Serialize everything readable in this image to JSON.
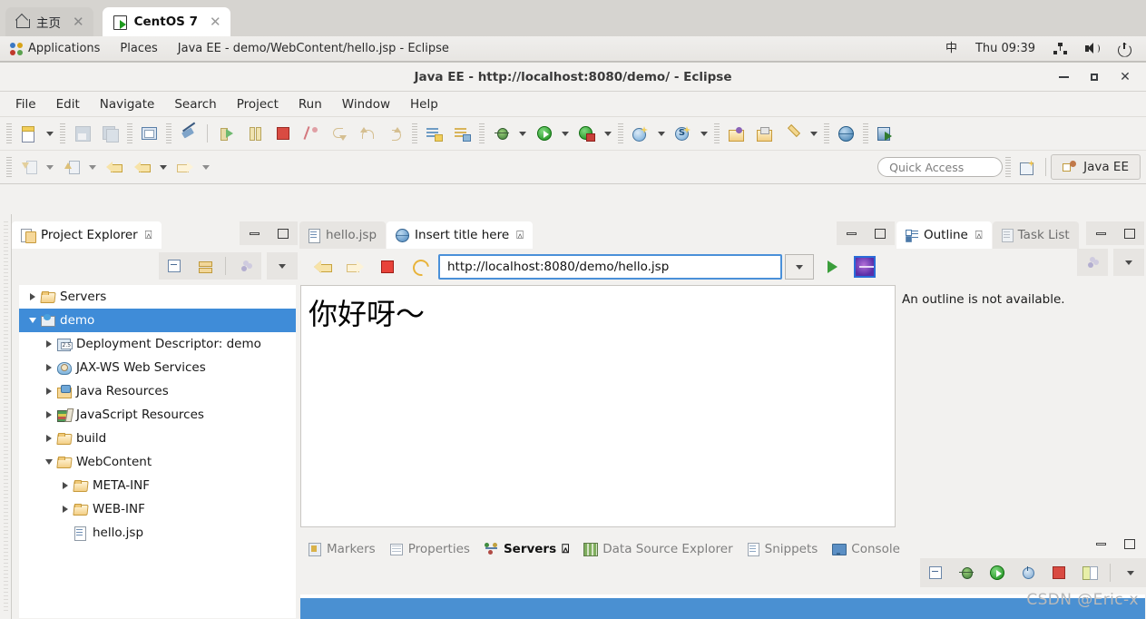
{
  "vm_tabs": [
    {
      "label": "主页",
      "icon": "home-icon",
      "active": false
    },
    {
      "label": "CentOS 7",
      "icon": "centos-icon",
      "active": true
    }
  ],
  "gnome_panel": {
    "applications": "Applications",
    "places": "Places",
    "window_title": "Java EE - demo/WebContent/hello.jsp - Eclipse",
    "input_method": "中",
    "clock": "Thu 09:39"
  },
  "eclipse": {
    "title": "Java EE - http://localhost:8080/demo/ - Eclipse",
    "menu": [
      "File",
      "Edit",
      "Navigate",
      "Search",
      "Project",
      "Run",
      "Window",
      "Help"
    ],
    "quick_access_placeholder": "Quick Access",
    "perspective": "Java EE"
  },
  "project_explorer": {
    "tab_label": "Project Explorer",
    "tree": [
      {
        "label": "Servers",
        "indent": 0,
        "twisty": "right",
        "icon": "folder-icon",
        "selected": false
      },
      {
        "label": "demo",
        "indent": 0,
        "twisty": "down",
        "icon": "project-icon",
        "selected": true
      },
      {
        "label": "Deployment Descriptor: demo",
        "indent": 1,
        "twisty": "right",
        "icon": "deployment-descriptor-icon",
        "selected": false
      },
      {
        "label": "JAX-WS Web Services",
        "indent": 1,
        "twisty": "right",
        "icon": "web-services-icon",
        "selected": false
      },
      {
        "label": "Java Resources",
        "indent": 1,
        "twisty": "right",
        "icon": "java-resources-icon",
        "selected": false
      },
      {
        "label": "JavaScript Resources",
        "indent": 1,
        "twisty": "right",
        "icon": "javascript-resources-icon",
        "selected": false
      },
      {
        "label": "build",
        "indent": 1,
        "twisty": "right",
        "icon": "folder-icon",
        "selected": false
      },
      {
        "label": "WebContent",
        "indent": 1,
        "twisty": "down",
        "icon": "folder-icon",
        "selected": false
      },
      {
        "label": "META-INF",
        "indent": 2,
        "twisty": "right",
        "icon": "folder-icon",
        "selected": false
      },
      {
        "label": "WEB-INF",
        "indent": 2,
        "twisty": "right",
        "icon": "folder-icon",
        "selected": false
      },
      {
        "label": "hello.jsp",
        "indent": 2,
        "twisty": "none",
        "icon": "jsp-file-icon",
        "selected": false
      }
    ]
  },
  "editor": {
    "tabs": [
      {
        "label": "hello.jsp",
        "icon": "jsp-file-icon",
        "active": false,
        "closable": false
      },
      {
        "label": "Insert title here",
        "icon": "globe-icon",
        "active": true,
        "closable": true
      }
    ],
    "browser": {
      "url": "http://localhost:8080/demo/hello.jsp",
      "page_text": "你好呀～"
    }
  },
  "outline": {
    "tabs": [
      {
        "label": "Outline",
        "icon": "outline-icon",
        "active": true,
        "closable": true
      },
      {
        "label": "Task List",
        "icon": "task-list-icon",
        "active": false,
        "closable": false
      }
    ],
    "empty_message": "An outline is not available."
  },
  "bottom_panel": {
    "tabs": [
      {
        "label": "Markers",
        "icon": "markers-icon",
        "active": false,
        "closable": false
      },
      {
        "label": "Properties",
        "icon": "properties-icon",
        "active": false,
        "closable": false
      },
      {
        "label": "Servers",
        "icon": "servers-icon",
        "active": true,
        "closable": true
      },
      {
        "label": "Data Source Explorer",
        "icon": "data-source-explorer-icon",
        "active": false,
        "closable": false
      },
      {
        "label": "Snippets",
        "icon": "snippets-icon",
        "active": false,
        "closable": false
      },
      {
        "label": "Console",
        "icon": "console-icon",
        "active": false,
        "closable": false
      }
    ]
  },
  "watermark": "CSDN @Eric-x",
  "colors": {
    "selection_blue": "#3f8cd8",
    "url_focus_blue": "#4a90d9",
    "panel_bg": "#f2f1ef",
    "tab_inactive": "#e7e5e2"
  }
}
